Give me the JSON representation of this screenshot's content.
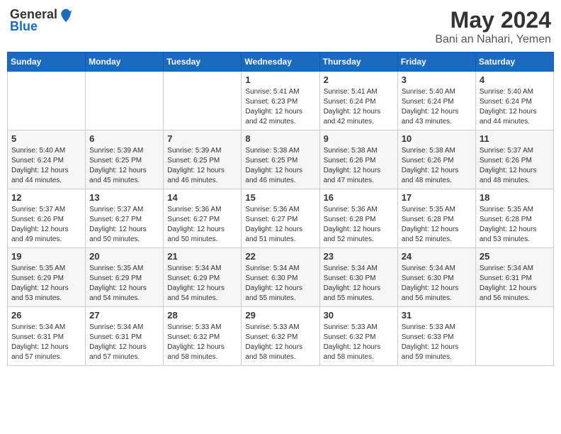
{
  "header": {
    "logo_general": "General",
    "logo_blue": "Blue",
    "month_title": "May 2024",
    "location": "Bani an Nahari, Yemen"
  },
  "weekdays": [
    "Sunday",
    "Monday",
    "Tuesday",
    "Wednesday",
    "Thursday",
    "Friday",
    "Saturday"
  ],
  "weeks": [
    [
      {
        "day": "",
        "sunrise": "",
        "sunset": "",
        "daylight": ""
      },
      {
        "day": "",
        "sunrise": "",
        "sunset": "",
        "daylight": ""
      },
      {
        "day": "",
        "sunrise": "",
        "sunset": "",
        "daylight": ""
      },
      {
        "day": "1",
        "sunrise": "Sunrise: 5:41 AM",
        "sunset": "Sunset: 6:23 PM",
        "daylight": "Daylight: 12 hours and 42 minutes."
      },
      {
        "day": "2",
        "sunrise": "Sunrise: 5:41 AM",
        "sunset": "Sunset: 6:24 PM",
        "daylight": "Daylight: 12 hours and 42 minutes."
      },
      {
        "day": "3",
        "sunrise": "Sunrise: 5:40 AM",
        "sunset": "Sunset: 6:24 PM",
        "daylight": "Daylight: 12 hours and 43 minutes."
      },
      {
        "day": "4",
        "sunrise": "Sunrise: 5:40 AM",
        "sunset": "Sunset: 6:24 PM",
        "daylight": "Daylight: 12 hours and 44 minutes."
      }
    ],
    [
      {
        "day": "5",
        "sunrise": "Sunrise: 5:40 AM",
        "sunset": "Sunset: 6:24 PM",
        "daylight": "Daylight: 12 hours and 44 minutes."
      },
      {
        "day": "6",
        "sunrise": "Sunrise: 5:39 AM",
        "sunset": "Sunset: 6:25 PM",
        "daylight": "Daylight: 12 hours and 45 minutes."
      },
      {
        "day": "7",
        "sunrise": "Sunrise: 5:39 AM",
        "sunset": "Sunset: 6:25 PM",
        "daylight": "Daylight: 12 hours and 46 minutes."
      },
      {
        "day": "8",
        "sunrise": "Sunrise: 5:38 AM",
        "sunset": "Sunset: 6:25 PM",
        "daylight": "Daylight: 12 hours and 46 minutes."
      },
      {
        "day": "9",
        "sunrise": "Sunrise: 5:38 AM",
        "sunset": "Sunset: 6:26 PM",
        "daylight": "Daylight: 12 hours and 47 minutes."
      },
      {
        "day": "10",
        "sunrise": "Sunrise: 5:38 AM",
        "sunset": "Sunset: 6:26 PM",
        "daylight": "Daylight: 12 hours and 48 minutes."
      },
      {
        "day": "11",
        "sunrise": "Sunrise: 5:37 AM",
        "sunset": "Sunset: 6:26 PM",
        "daylight": "Daylight: 12 hours and 48 minutes."
      }
    ],
    [
      {
        "day": "12",
        "sunrise": "Sunrise: 5:37 AM",
        "sunset": "Sunset: 6:26 PM",
        "daylight": "Daylight: 12 hours and 49 minutes."
      },
      {
        "day": "13",
        "sunrise": "Sunrise: 5:37 AM",
        "sunset": "Sunset: 6:27 PM",
        "daylight": "Daylight: 12 hours and 50 minutes."
      },
      {
        "day": "14",
        "sunrise": "Sunrise: 5:36 AM",
        "sunset": "Sunset: 6:27 PM",
        "daylight": "Daylight: 12 hours and 50 minutes."
      },
      {
        "day": "15",
        "sunrise": "Sunrise: 5:36 AM",
        "sunset": "Sunset: 6:27 PM",
        "daylight": "Daylight: 12 hours and 51 minutes."
      },
      {
        "day": "16",
        "sunrise": "Sunrise: 5:36 AM",
        "sunset": "Sunset: 6:28 PM",
        "daylight": "Daylight: 12 hours and 52 minutes."
      },
      {
        "day": "17",
        "sunrise": "Sunrise: 5:35 AM",
        "sunset": "Sunset: 6:28 PM",
        "daylight": "Daylight: 12 hours and 52 minutes."
      },
      {
        "day": "18",
        "sunrise": "Sunrise: 5:35 AM",
        "sunset": "Sunset: 6:28 PM",
        "daylight": "Daylight: 12 hours and 53 minutes."
      }
    ],
    [
      {
        "day": "19",
        "sunrise": "Sunrise: 5:35 AM",
        "sunset": "Sunset: 6:29 PM",
        "daylight": "Daylight: 12 hours and 53 minutes."
      },
      {
        "day": "20",
        "sunrise": "Sunrise: 5:35 AM",
        "sunset": "Sunset: 6:29 PM",
        "daylight": "Daylight: 12 hours and 54 minutes."
      },
      {
        "day": "21",
        "sunrise": "Sunrise: 5:34 AM",
        "sunset": "Sunset: 6:29 PM",
        "daylight": "Daylight: 12 hours and 54 minutes."
      },
      {
        "day": "22",
        "sunrise": "Sunrise: 5:34 AM",
        "sunset": "Sunset: 6:30 PM",
        "daylight": "Daylight: 12 hours and 55 minutes."
      },
      {
        "day": "23",
        "sunrise": "Sunrise: 5:34 AM",
        "sunset": "Sunset: 6:30 PM",
        "daylight": "Daylight: 12 hours and 55 minutes."
      },
      {
        "day": "24",
        "sunrise": "Sunrise: 5:34 AM",
        "sunset": "Sunset: 6:30 PM",
        "daylight": "Daylight: 12 hours and 56 minutes."
      },
      {
        "day": "25",
        "sunrise": "Sunrise: 5:34 AM",
        "sunset": "Sunset: 6:31 PM",
        "daylight": "Daylight: 12 hours and 56 minutes."
      }
    ],
    [
      {
        "day": "26",
        "sunrise": "Sunrise: 5:34 AM",
        "sunset": "Sunset: 6:31 PM",
        "daylight": "Daylight: 12 hours and 57 minutes."
      },
      {
        "day": "27",
        "sunrise": "Sunrise: 5:34 AM",
        "sunset": "Sunset: 6:31 PM",
        "daylight": "Daylight: 12 hours and 57 minutes."
      },
      {
        "day": "28",
        "sunrise": "Sunrise: 5:33 AM",
        "sunset": "Sunset: 6:32 PM",
        "daylight": "Daylight: 12 hours and 58 minutes."
      },
      {
        "day": "29",
        "sunrise": "Sunrise: 5:33 AM",
        "sunset": "Sunset: 6:32 PM",
        "daylight": "Daylight: 12 hours and 58 minutes."
      },
      {
        "day": "30",
        "sunrise": "Sunrise: 5:33 AM",
        "sunset": "Sunset: 6:32 PM",
        "daylight": "Daylight: 12 hours and 58 minutes."
      },
      {
        "day": "31",
        "sunrise": "Sunrise: 5:33 AM",
        "sunset": "Sunset: 6:33 PM",
        "daylight": "Daylight: 12 hours and 59 minutes."
      },
      {
        "day": "",
        "sunrise": "",
        "sunset": "",
        "daylight": ""
      }
    ]
  ]
}
